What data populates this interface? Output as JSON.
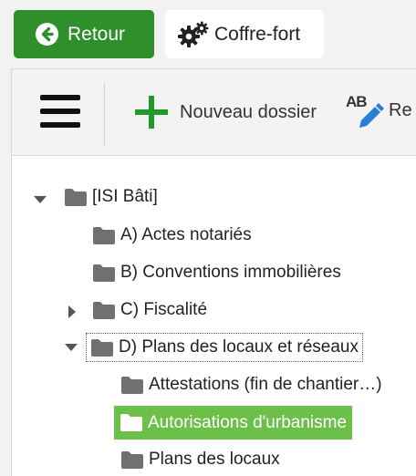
{
  "top_buttons": {
    "back_label": "Retour",
    "vault_label": "Coffre-fort"
  },
  "toolbar": {
    "menu_icon": "hamburger-icon",
    "new_folder_label": "Nouveau dossier",
    "rename_label": "Re"
  },
  "tree": {
    "root": {
      "label": "[ISI Bâti]",
      "expanded": true
    },
    "items": [
      {
        "label": "A) Actes notariés",
        "has_children": false
      },
      {
        "label": "B) Conventions immobilières",
        "has_children": false
      },
      {
        "label": "C) Fiscalité",
        "has_children": true,
        "expanded": false
      },
      {
        "label": "D) Plans des locaux et réseaux",
        "has_children": true,
        "expanded": true,
        "focused": true
      },
      {
        "label": "Attestations (fin de chantier…)",
        "level": 2
      },
      {
        "label": "Autorisations d'urbanisme",
        "level": 2,
        "selected": true
      },
      {
        "label": "Plans des locaux",
        "level": 2
      }
    ]
  },
  "colors": {
    "back_button": "#2f8f2a",
    "plus_icon": "#1f9a2b",
    "selected_row": "#6cc04a",
    "pencil_icon": "#2a7fd4",
    "folder": "#707070"
  }
}
